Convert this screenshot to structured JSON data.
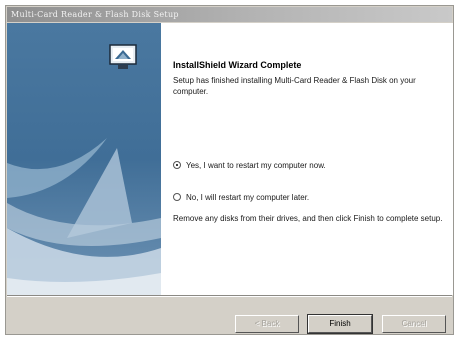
{
  "window": {
    "title": "Multi-Card Reader & Flash Disk Setup"
  },
  "content": {
    "heading": "InstallShield Wizard Complete",
    "description": "Setup has finished installing Multi-Card Reader & Flash Disk on your computer.",
    "radio_restart_now": "Yes, I want to restart my computer now.",
    "radio_restart_later": "No, I will restart my computer later.",
    "note": "Remove any disks from their drives, and then click Finish to complete setup."
  },
  "buttons": {
    "back": "< Back",
    "finish": "Finish",
    "cancel": "Cancel"
  },
  "colors": {
    "panel_dark": "#3f6f9a",
    "panel_light": "#9db5c9"
  },
  "icons": {
    "wizard": "installshield-computer-icon"
  }
}
